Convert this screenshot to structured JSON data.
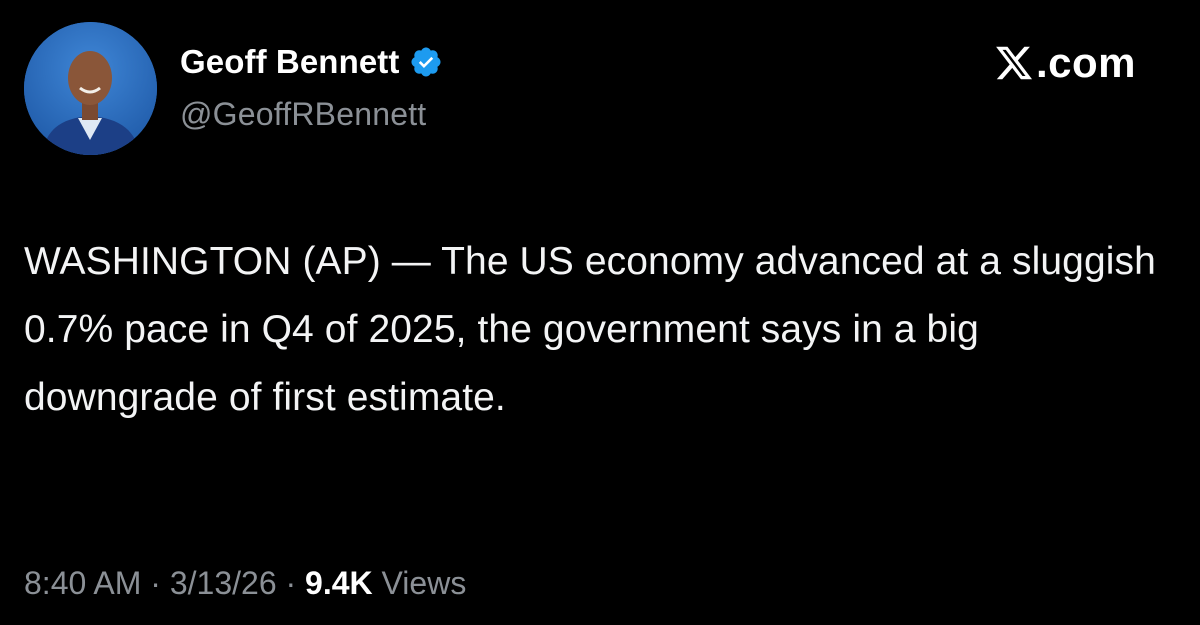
{
  "author": {
    "name": "Geoff Bennett",
    "handle": "@GeoffRBennett",
    "verified": true,
    "avatar_icon": "profile-photo"
  },
  "brand": {
    "domain": ".com",
    "logo_icon": "x-logo-icon"
  },
  "tweet": {
    "text": "WASHINGTON (AP) — The US economy advanced at a sluggish 0.7% pace in Q4 of 2025, the government says in a big downgrade of first estimate."
  },
  "meta": {
    "time": "8:40 AM",
    "separator": " · ",
    "date": "3/13/26",
    "views_count": "9.4K",
    "views_label": " Views"
  },
  "colors": {
    "background": "#000000",
    "text_primary": "#e7e9ea",
    "text_secondary": "#8b9096",
    "verified_blue": "#1d9bf0"
  }
}
